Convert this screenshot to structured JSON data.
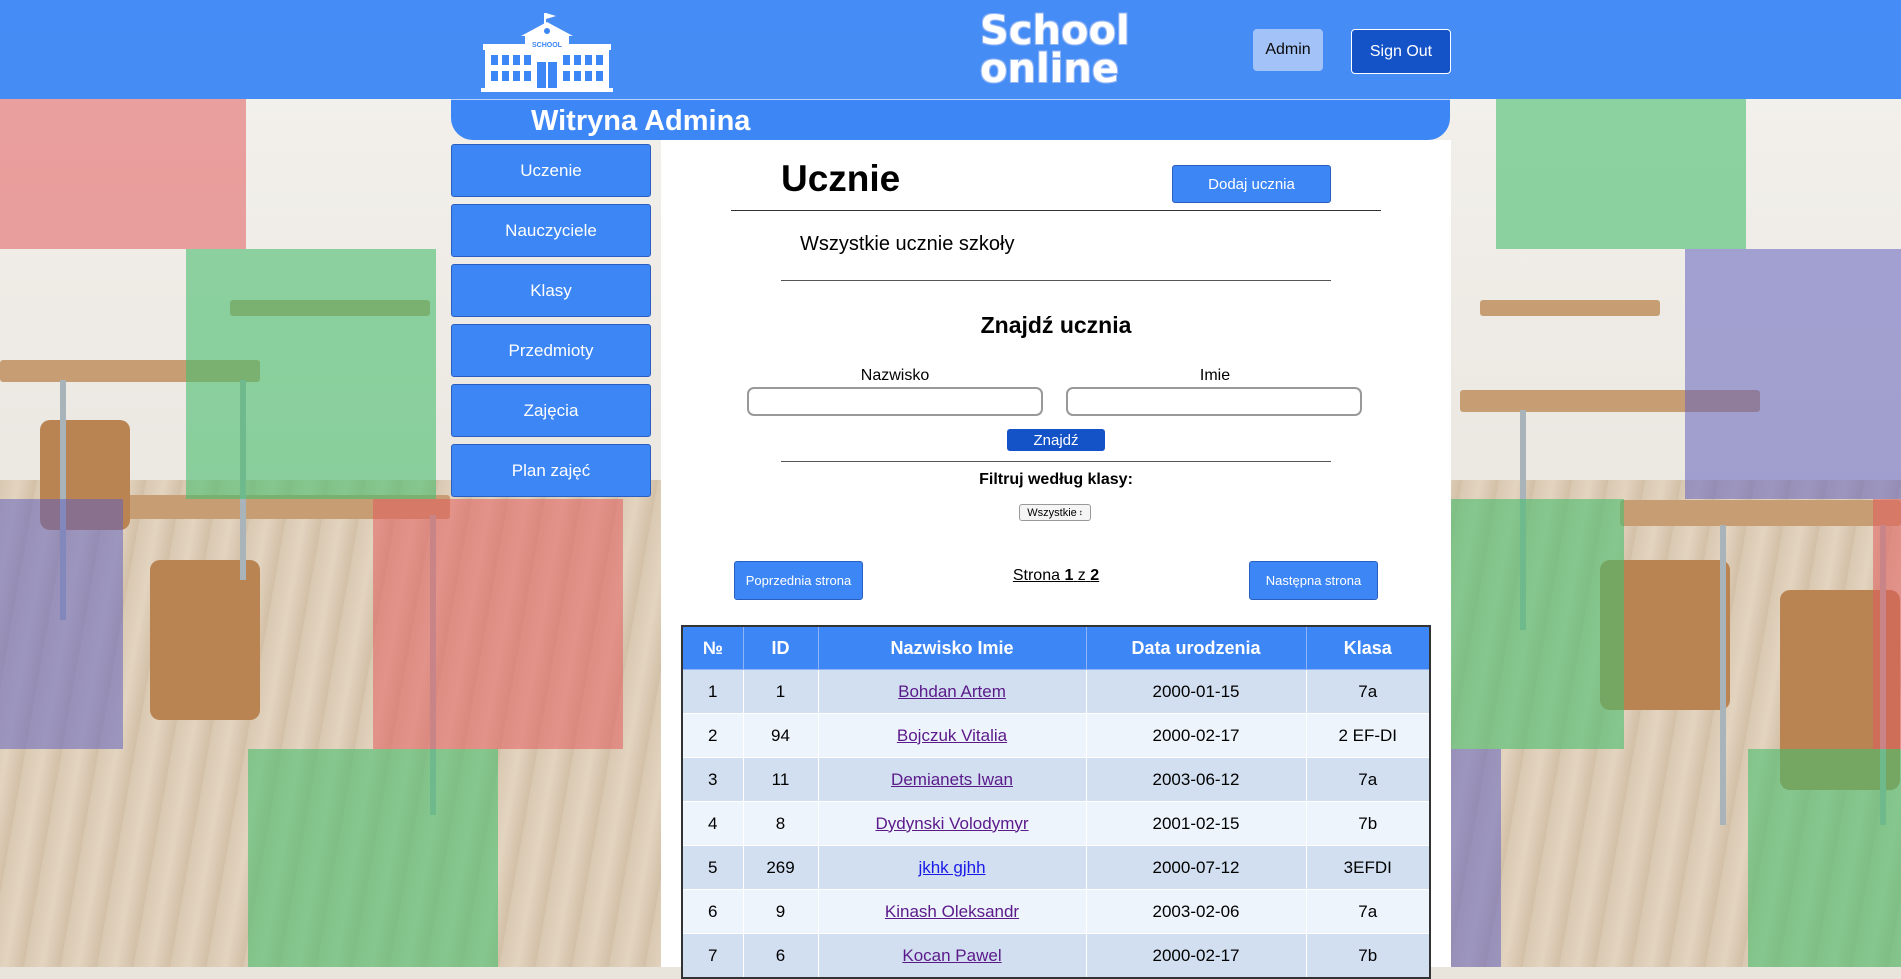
{
  "brand": {
    "line1": "School",
    "line2": "online"
  },
  "header": {
    "admin_label": "Admin",
    "signout_label": "Sign Out"
  },
  "banner": {
    "title": "Witryna Admina"
  },
  "sidebar": {
    "items": [
      {
        "label": "Uczenie"
      },
      {
        "label": "Nauczyciele"
      },
      {
        "label": "Klasy"
      },
      {
        "label": "Przedmioty"
      },
      {
        "label": "Zajęcia"
      },
      {
        "label": "Plan zajęć"
      }
    ]
  },
  "main": {
    "title": "Ucznie",
    "add_label": "Dodaj ucznia",
    "subtitle": "Wszystkie ucznie szkoły",
    "search_title": "Znajdź ucznia",
    "surname_label": "Nazwisko",
    "surname_value": "",
    "name_label": "Imie",
    "name_value": "",
    "search_label": "Znajdź",
    "filter_label": "Filtruj według klasy:",
    "filter_value": "Wszystkie"
  },
  "pagination": {
    "prev_label": "Poprzednia strona",
    "next_label": "Następna strona",
    "text": "Strona",
    "current": "1",
    "of": "z",
    "total": "2"
  },
  "table": {
    "headers": [
      "№",
      "ID",
      "Nazwisko Imie",
      "Data urodzenia",
      "Klasa"
    ],
    "rows": [
      [
        "1",
        "1",
        "Bohdan Artem",
        "2000-01-15",
        "7a"
      ],
      [
        "2",
        "94",
        "Bojczuk Vitalia",
        "2000-02-17",
        "2 EF-DI"
      ],
      [
        "3",
        "11",
        "Demianets Iwan",
        "2003-06-12",
        "7a"
      ],
      [
        "4",
        "8",
        "Dydynski Volodymyr",
        "2001-02-15",
        "7b"
      ],
      [
        "5",
        "269",
        "jkhk gjhh",
        "2000-07-12",
        "3EFDI"
      ],
      [
        "6",
        "9",
        "Kinash Oleksandr",
        "2003-02-06",
        "7a"
      ],
      [
        "7",
        "6",
        "Kocan Pawel",
        "2000-02-17",
        "7b"
      ]
    ]
  },
  "colors": {
    "header_bg": "#3c86f5",
    "button_dark": "#1452c7",
    "table_odd": "#d2dff0",
    "table_even": "#eef4fc",
    "link_visited": "#5a1a8a",
    "link_unvisited": "#1a1ae6"
  }
}
